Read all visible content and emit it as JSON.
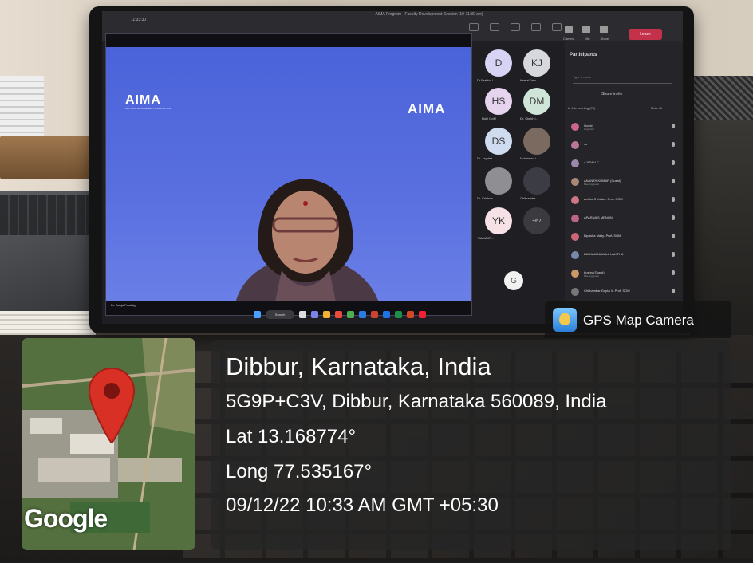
{
  "teams": {
    "window_title": "AIMA Program - Faculty Development Session [10-11:30 am]",
    "tab_name": "11:33:30",
    "controls": [
      "Camera",
      "Mic",
      "Share"
    ],
    "leave_label": "Leave",
    "speaker_name": "Dr. Ashja Farahig",
    "aima_text": "AIMA",
    "aima_sub": "ALL INDIA MANAGEMENT ASSOCIATION",
    "search_label": "Search",
    "tiles": [
      {
        "initials": "D",
        "name": "Dr.Prabhu L...",
        "color": "#d7d3f5"
      },
      {
        "initials": "KJ",
        "name": "Kamal Jain...",
        "color": "#d6d8de"
      },
      {
        "initials": "HS",
        "name": "HoD GoM",
        "color": "#e6d3ee"
      },
      {
        "initials": "DM",
        "name": "Dr. Shekh i...",
        "color": "#cfe5d8"
      },
      {
        "initials": "DS",
        "name": "Dr. Jagdee...",
        "color": "#cfdcef"
      },
      {
        "initials": "",
        "name": "Mohamed i...",
        "color": "#7b6a60"
      },
      {
        "initials": "",
        "name": "Dr. Krishna...",
        "color": "#8f8f93"
      },
      {
        "initials": "",
        "name": "Chithamba...",
        "color": "#3c3c44"
      },
      {
        "initials": "YK",
        "name": "YAMARIR...",
        "color": "#f6e1e6"
      },
      {
        "initials": "+67",
        "name": "",
        "color": "#3a3a3f"
      }
    ],
    "g_initial": "G",
    "participants": {
      "title": "Participants",
      "search_placeholder": "Type a name",
      "share_invite": "Share invite",
      "in_meeting": "In this meeting (78)",
      "mute_all": "Mute all",
      "people": [
        {
          "name": "Guest",
          "sub": "Organizer",
          "color": "#c68"
        },
        {
          "name": "ss",
          "sub": "",
          "color": "#b79"
        },
        {
          "name": "AJITH V C",
          "sub": "",
          "color": "#98a"
        },
        {
          "name": "ANANTH KUMAR (Guest)",
          "sub": "Meeting guest",
          "color": "#a87"
        },
        {
          "name": "Anitha S Yadav- Prof- SOM",
          "sub": "",
          "color": "#c78"
        },
        {
          "name": "APARNA S MENON",
          "sub": "",
          "color": "#b68"
        },
        {
          "name": "Bipasha Maity- Prof- SOM",
          "sub": "",
          "color": "#c67"
        },
        {
          "name": "BUDAMANAVALA LALITHA",
          "sub": "",
          "color": "#78a"
        },
        {
          "name": "bushra(Guest)",
          "sub": "Meeting guest",
          "color": "#c96"
        },
        {
          "name": "Chithambar Gupta V- Prof- SOM",
          "sub": "",
          "color": "#777"
        }
      ]
    }
  },
  "gps": {
    "app_label": "GPS Map Camera",
    "place": "Dibbur, Karnataka, India",
    "address": "5G9P+C3V, Dibbur, Karnataka 560089, India",
    "lat": "Lat 13.168774°",
    "long": "Long 77.535167°",
    "datetime": "09/12/22 10:33 AM GMT +05:30",
    "map_brand": "Google",
    "pin_color": "#d93025"
  }
}
